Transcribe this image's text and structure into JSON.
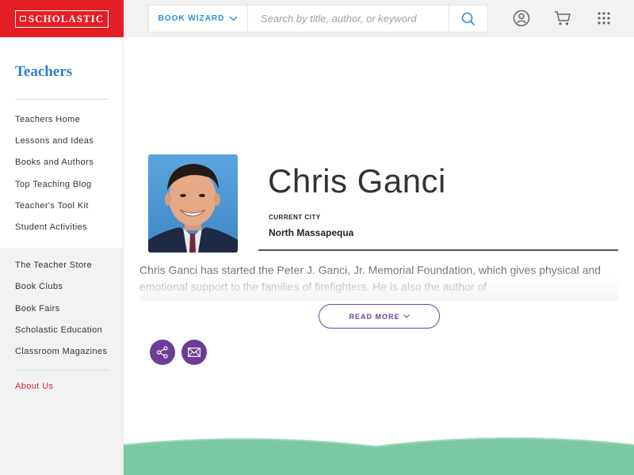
{
  "header": {
    "logo_text": "SCHOLASTIC",
    "book_wizard_label": "BOOK WIZARD",
    "search_placeholder": "Search by title, author, or keyword",
    "icons": [
      "user-account-icon",
      "shopping-cart-icon",
      "apps-grid-icon"
    ]
  },
  "sidebar": {
    "title": "Teachers",
    "primary_links": [
      "Teachers Home",
      "Lessons and Ideas",
      "Books and Authors",
      "Top Teaching Blog",
      "Teacher's Tool Kit",
      "Student Activities"
    ],
    "secondary_links": [
      "The Teacher Store",
      "Book Clubs",
      "Book Fairs",
      "Scholastic Education",
      "Classroom Magazines"
    ],
    "footer_link": "About Us"
  },
  "profile": {
    "name": "Chris Ganci",
    "city_label": "CURRENT CITY",
    "city": "North Massapequa",
    "bio": "Chris Ganci has started the Peter J. Ganci, Jr. Memorial Foundation, which gives physical and emotional support to the families of firefighters. He is also the author of",
    "read_more_label": "READ MORE"
  },
  "actions": {
    "icons": [
      "share-icon",
      "email-icon"
    ]
  },
  "colors": {
    "brand_red": "#e31e24",
    "link_blue": "#2d7dd2",
    "accent_purple": "#6b3d99",
    "wave_green": "#7bc8a4"
  }
}
